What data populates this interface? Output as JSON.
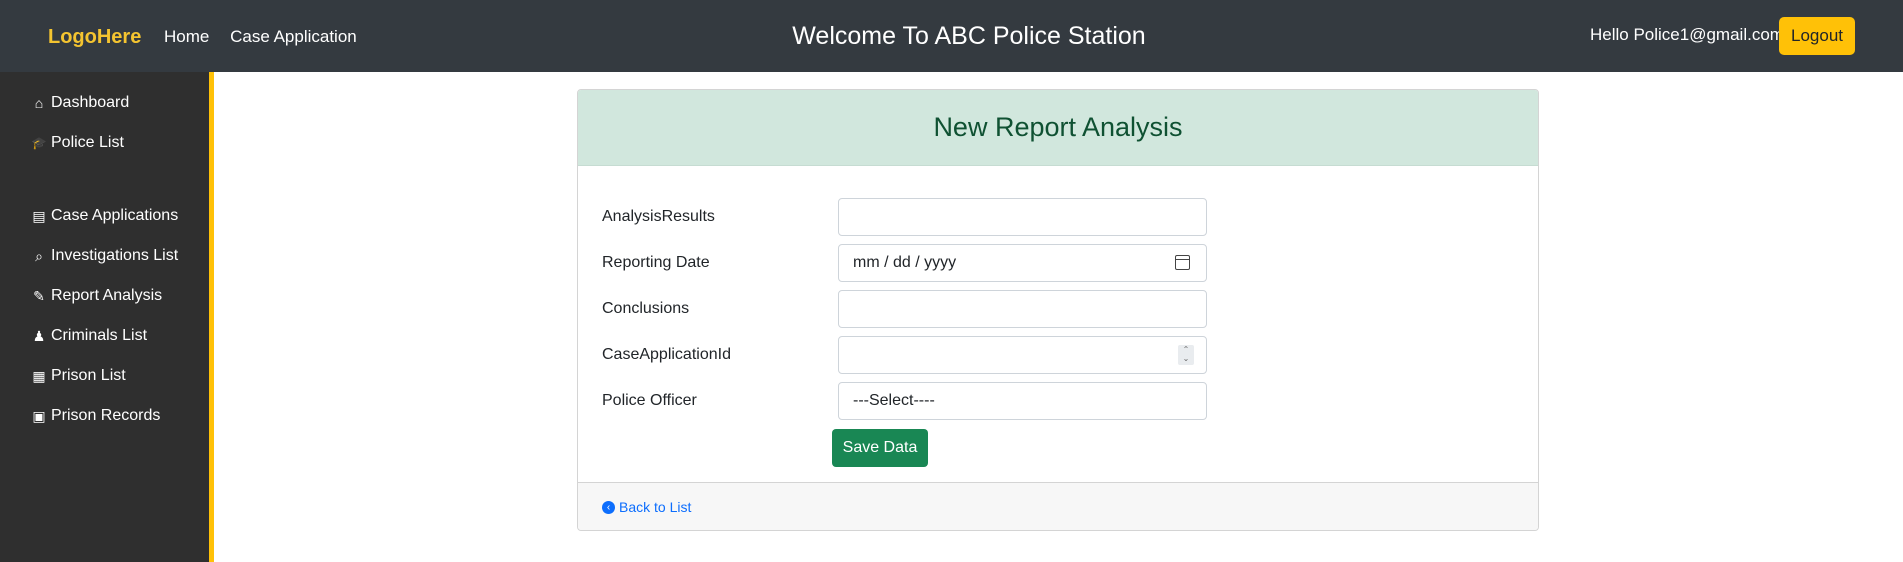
{
  "header": {
    "logo": "LogoHere",
    "nav": [
      "Home",
      "Case Application"
    ],
    "welcome": "Welcome To ABC Police Station",
    "greeting": "Hello Police1@gmail.com!",
    "logout_label": "Logout"
  },
  "sidebar": {
    "items": [
      {
        "label": "Dashboard",
        "icon": "home-icon",
        "glyph": "⌂"
      },
      {
        "label": "Police List",
        "icon": "graduation-cap-icon",
        "glyph": "🎓"
      },
      {
        "label": "Case Applications",
        "icon": "file-icon",
        "glyph": "▤"
      },
      {
        "label": "Investigations List",
        "icon": "search-icon",
        "glyph": "⌕"
      },
      {
        "label": "Report Analysis",
        "icon": "edit-icon",
        "glyph": "✎"
      },
      {
        "label": "Criminals List",
        "icon": "user-secret-icon",
        "glyph": "♟"
      },
      {
        "label": "Prison List",
        "icon": "grid-icon",
        "glyph": "▦"
      },
      {
        "label": "Prison Records",
        "icon": "id-card-icon",
        "glyph": "▣"
      }
    ]
  },
  "form": {
    "title": "New Report Analysis",
    "fields": [
      {
        "label": "AnalysisResults",
        "value": ""
      },
      {
        "label": "Reporting Date",
        "value": "mm / dd / yyyy"
      },
      {
        "label": "Conclusions",
        "value": ""
      },
      {
        "label": "CaseApplicationId",
        "value": ""
      },
      {
        "label": "Police Officer",
        "value": "---Select----"
      }
    ],
    "save_label": "Save Data",
    "back_label": "Back to List"
  },
  "colors": {
    "topbar": "#343a40",
    "accent": "#ffc107",
    "header_bg": "#d1e7dd",
    "save": "#198754",
    "link": "#0d6efd"
  }
}
